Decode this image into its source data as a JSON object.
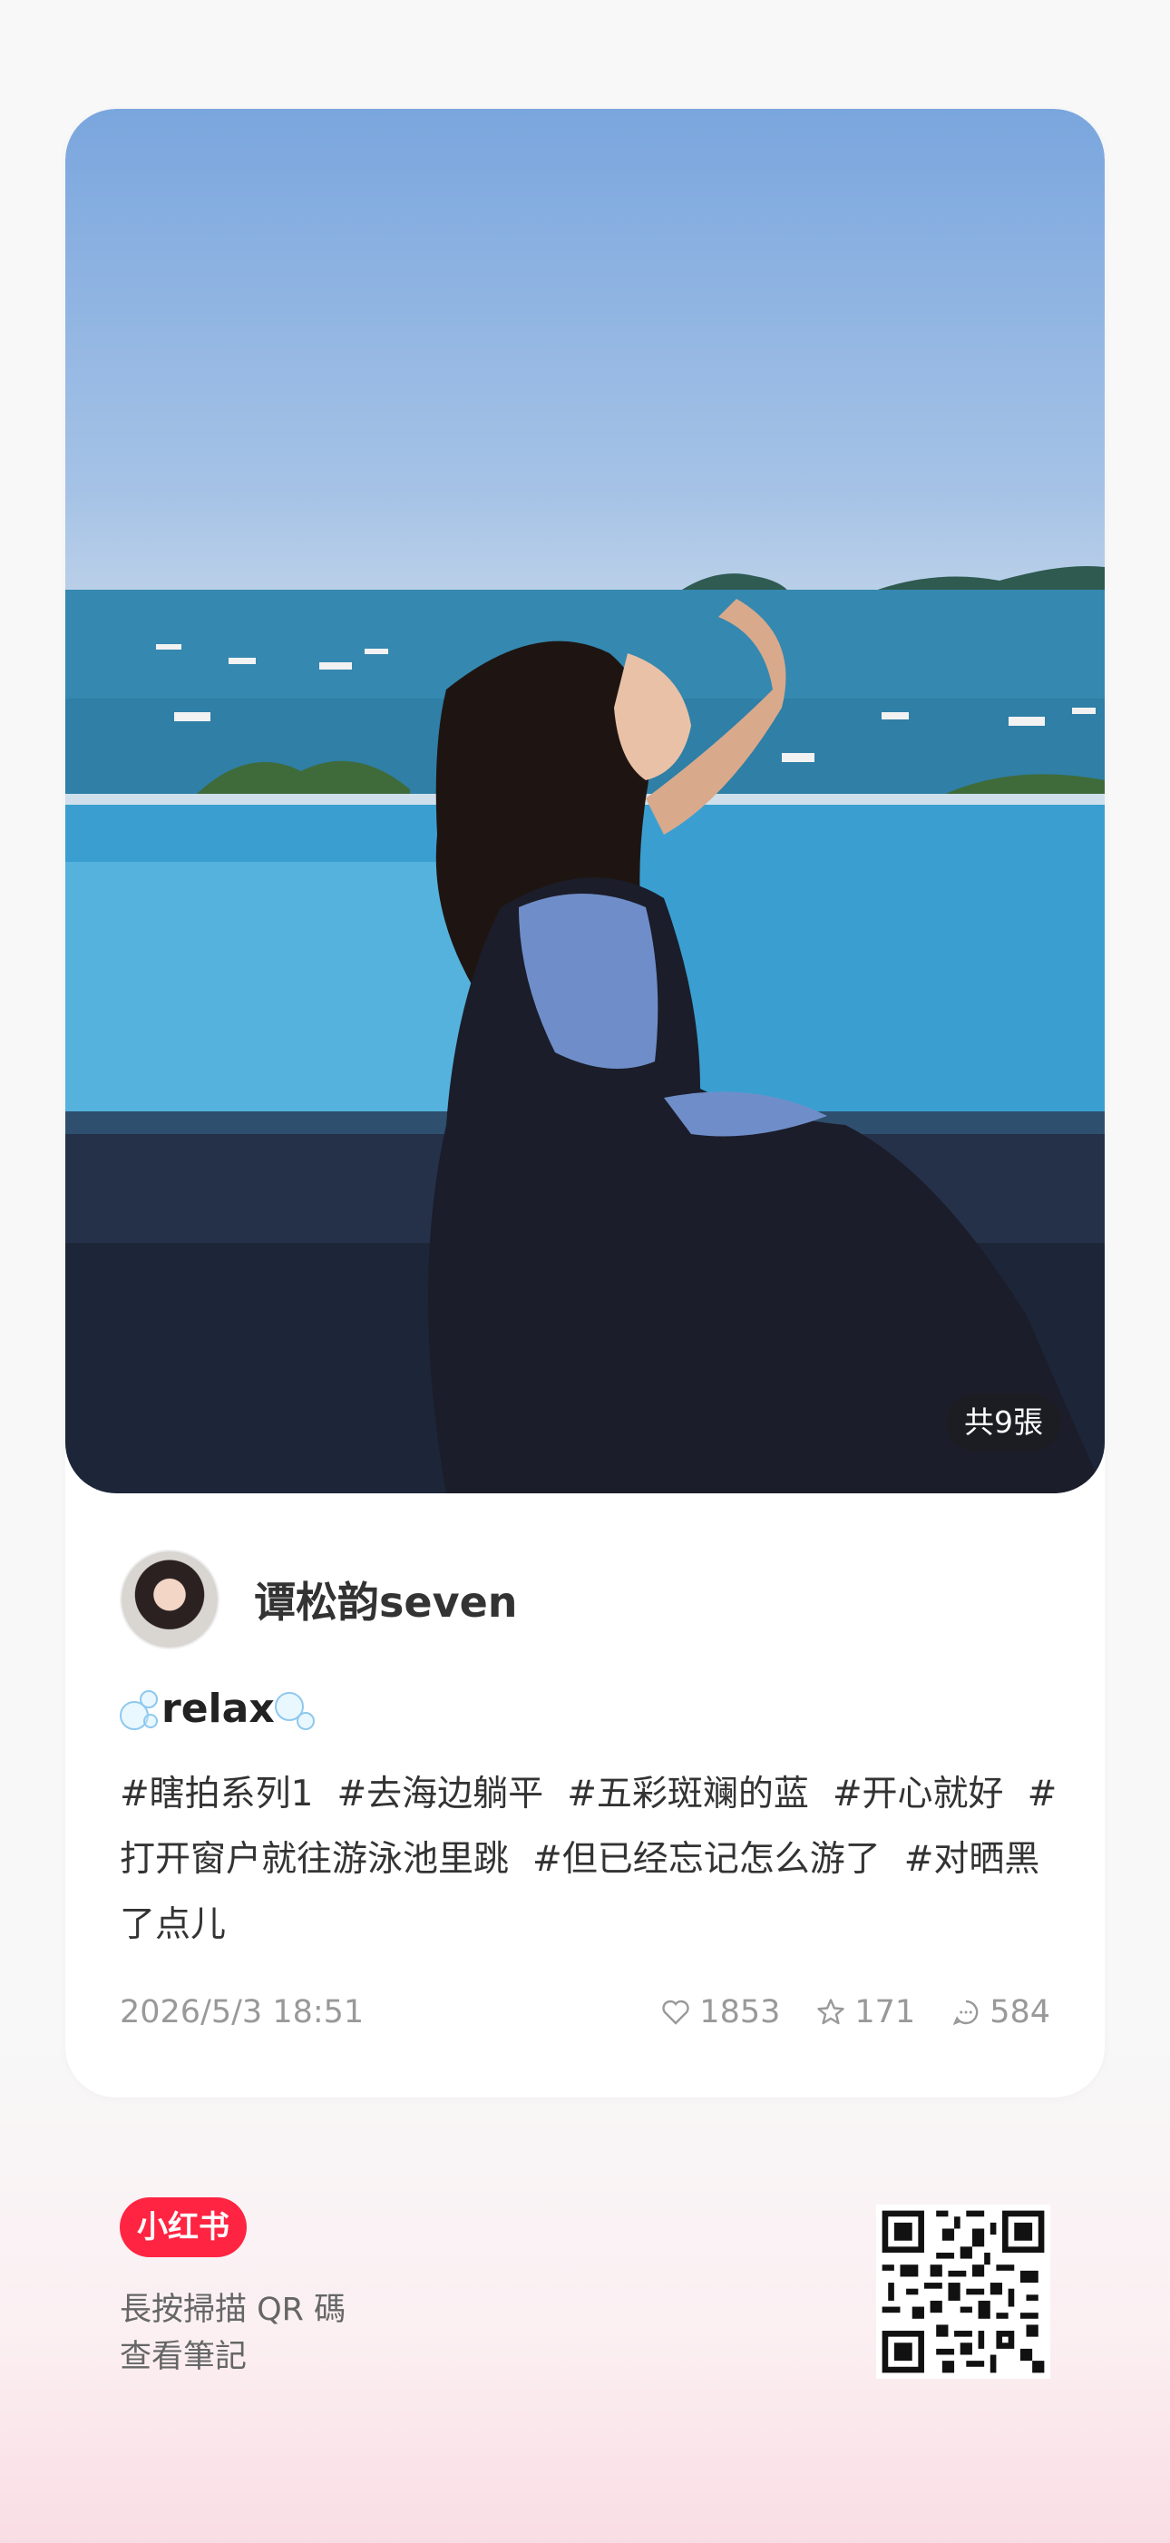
{
  "photo": {
    "count_label": "共9張"
  },
  "author": {
    "name": "谭松韵seven"
  },
  "note": {
    "title": "relax",
    "tags": [
      "#瞎拍系列1",
      "#去海边躺平",
      "#五彩斑斓的蓝",
      "#开心就好",
      "#打开窗户就往游泳池里跳",
      "#但已经忘记怎么游了",
      "#对晒黑了点儿"
    ],
    "date": "2026/5/3 18:51",
    "likes": "1853",
    "collects": "171",
    "comments": "584"
  },
  "footer": {
    "logo": "小红书",
    "line1": "長按掃描 QR 碼",
    "line2": "查看筆記"
  },
  "colors": {
    "brand": "#ff2442",
    "muted": "#999999"
  }
}
